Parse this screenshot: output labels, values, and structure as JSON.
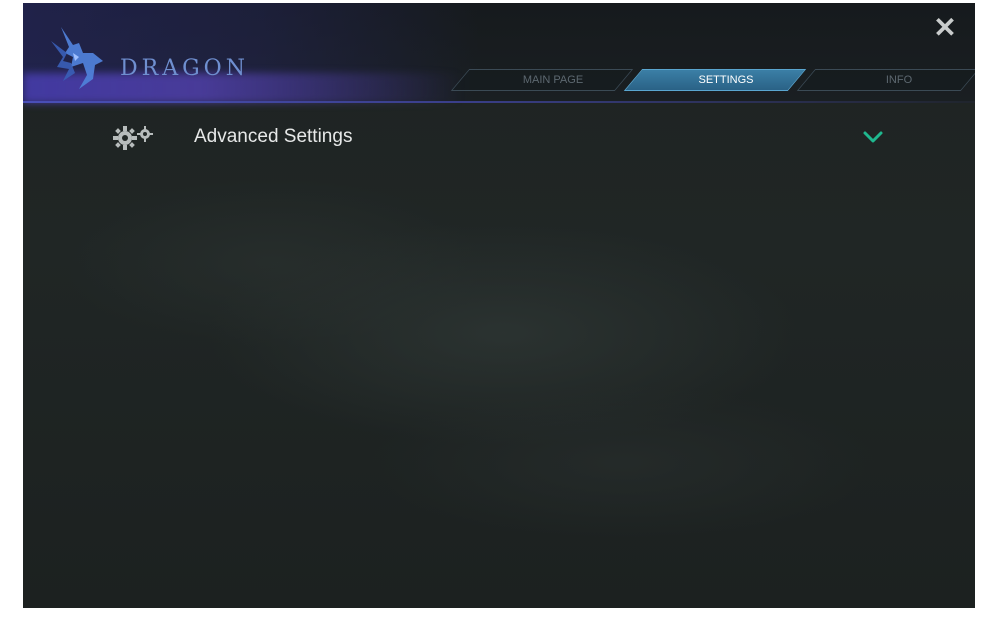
{
  "app": {
    "name": "DRAGON"
  },
  "window": {
    "close_glyph": "✕"
  },
  "tabs": [
    {
      "label": "MAIN PAGE",
      "active": false
    },
    {
      "label": "SETTINGS",
      "active": true
    },
    {
      "label": "INFO",
      "active": false
    }
  ],
  "section": {
    "title": "Advanced Settings",
    "icon": "gears-icon",
    "expand_icon": "chevron-down-icon",
    "expanded": false
  },
  "colors": {
    "accent": "#1fb88f",
    "tab_active": "#3b7fa6",
    "brand_text": "#6f8fd0"
  }
}
